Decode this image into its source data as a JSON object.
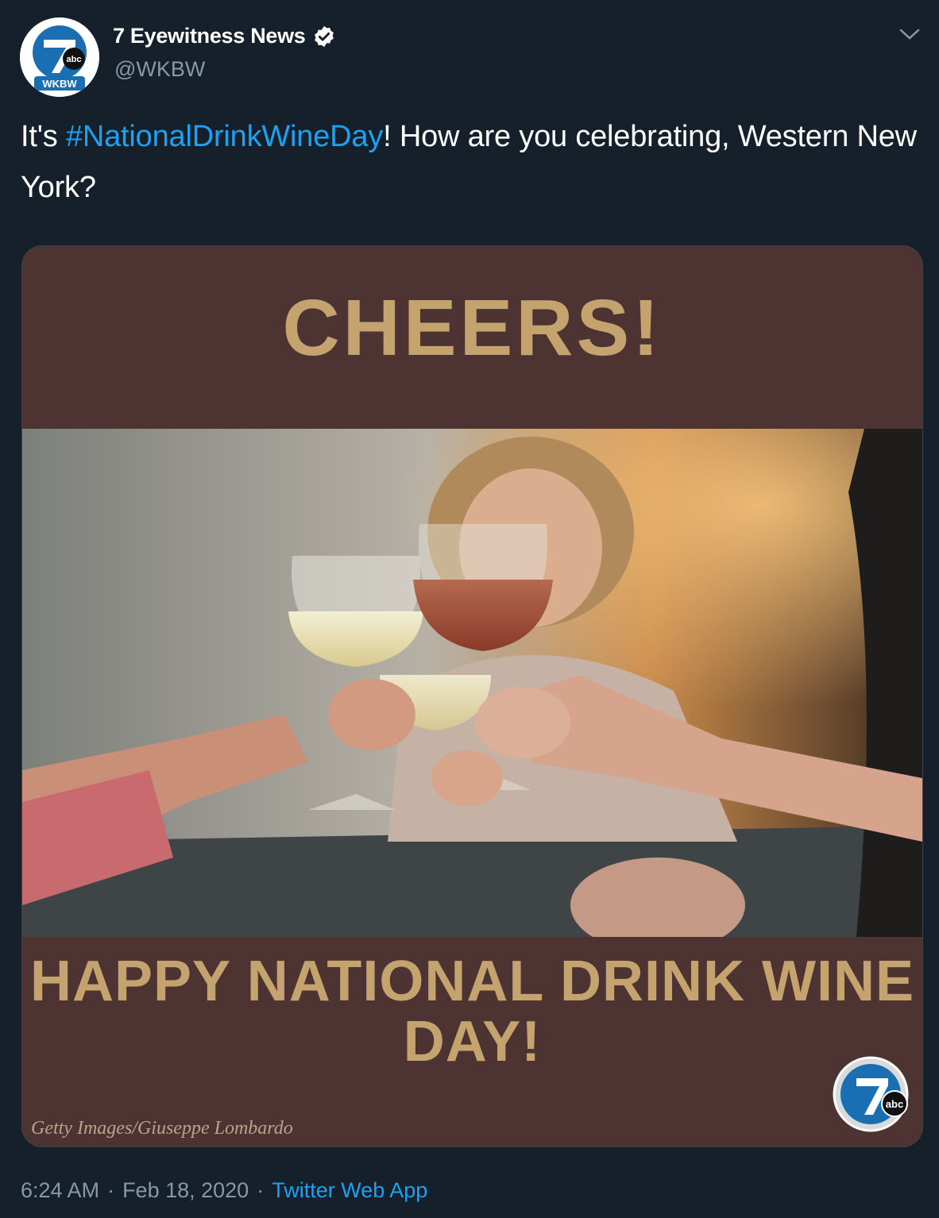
{
  "account": {
    "display_name": "7 Eyewitness News",
    "handle": "@WKBW",
    "verified": true,
    "avatar_text": "WKBW",
    "avatar_logo_text": "abc"
  },
  "tweet": {
    "text_before": "It's ",
    "hashtag": "#NationalDrinkWineDay",
    "text_after": "! How are you celebrating, Western New York?"
  },
  "media": {
    "headline": "CHEERS!",
    "subheadline": "HAPPY NATIONAL DRINK WINE DAY!",
    "credit": "Getty Images/Giuseppe Lombardo",
    "badge_logo_text": "abc"
  },
  "meta": {
    "time": "6:24 AM",
    "separator": "·",
    "date": "Feb 18, 2020",
    "source": "Twitter Web App"
  },
  "colors": {
    "background": "#15202b",
    "link": "#1da1f2",
    "muted": "#8899a6",
    "banner": "#4d3432",
    "gold": "#c5a36f"
  }
}
